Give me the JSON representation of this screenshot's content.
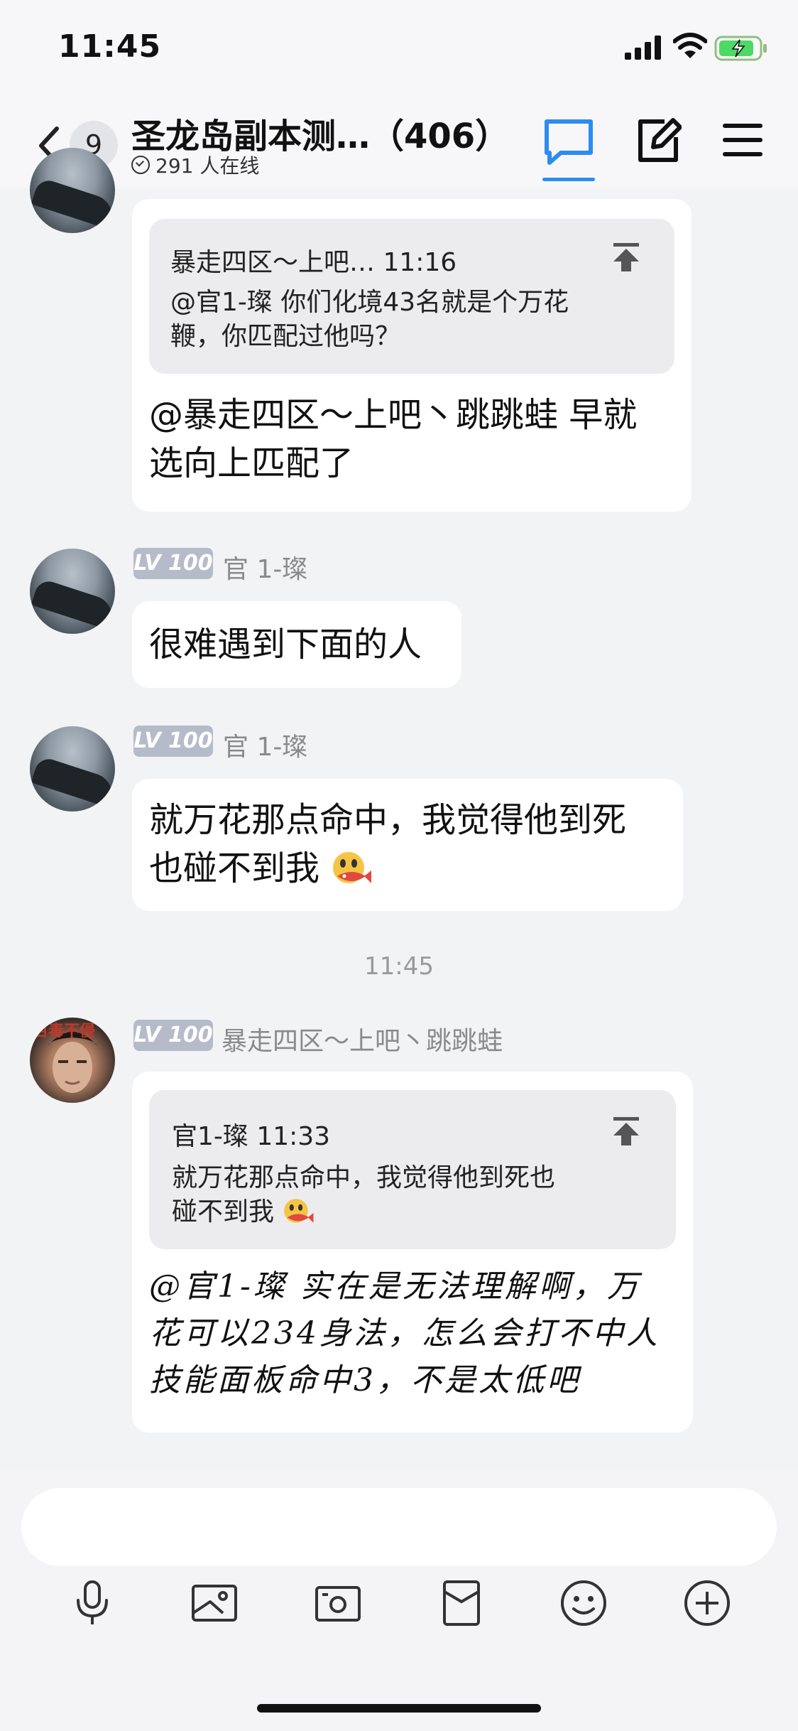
{
  "status_bar": {
    "time": "11:45"
  },
  "header": {
    "unread_count": "9",
    "title": "圣龙岛副本测…（406）",
    "online_text": "291 人在线"
  },
  "messages": [
    {
      "quote": {
        "head": "暴走四区～上吧… 11:16",
        "body_1": "@官1-璨 你们化境43名就是个万花",
        "body_2": "鞭，你匹配过他吗？"
      },
      "line_1": "@暴走四区～上吧丶跳跳蛙 早就",
      "line_2": "选向上匹配了"
    },
    {
      "level": "LV 100",
      "nickname": "官 1-璨",
      "text": "很难遇到下面的人"
    },
    {
      "level": "LV 100",
      "nickname": "官 1-璨",
      "line_1": "就万花那点命中，我觉得他到死",
      "line_2": "也碰不到我"
    }
  ],
  "time_divider": "11:45",
  "last_message": {
    "level": "LV 100",
    "nickname": "暴走四区～上吧丶跳跳蛙",
    "avatar_badge": "百毒不侵",
    "quote": {
      "head": "官1-璨 11:33",
      "body_1": "就万花那点命中，我觉得他到死也",
      "body_2": "碰不到我"
    },
    "line_1": "@官1-璨 实在是无法理解啊，万",
    "line_2": "花可以234身法，怎么会打不中人",
    "line_3": "技能面板命中3，不是太低吧"
  },
  "toolbar": {
    "icons": [
      "microphone-icon",
      "image-icon",
      "camera-icon",
      "red-packet-icon",
      "emoji-icon",
      "plus-icon"
    ]
  },
  "colors": {
    "accent": "#2d8cf0",
    "level_badge": "#b5bbc9"
  }
}
